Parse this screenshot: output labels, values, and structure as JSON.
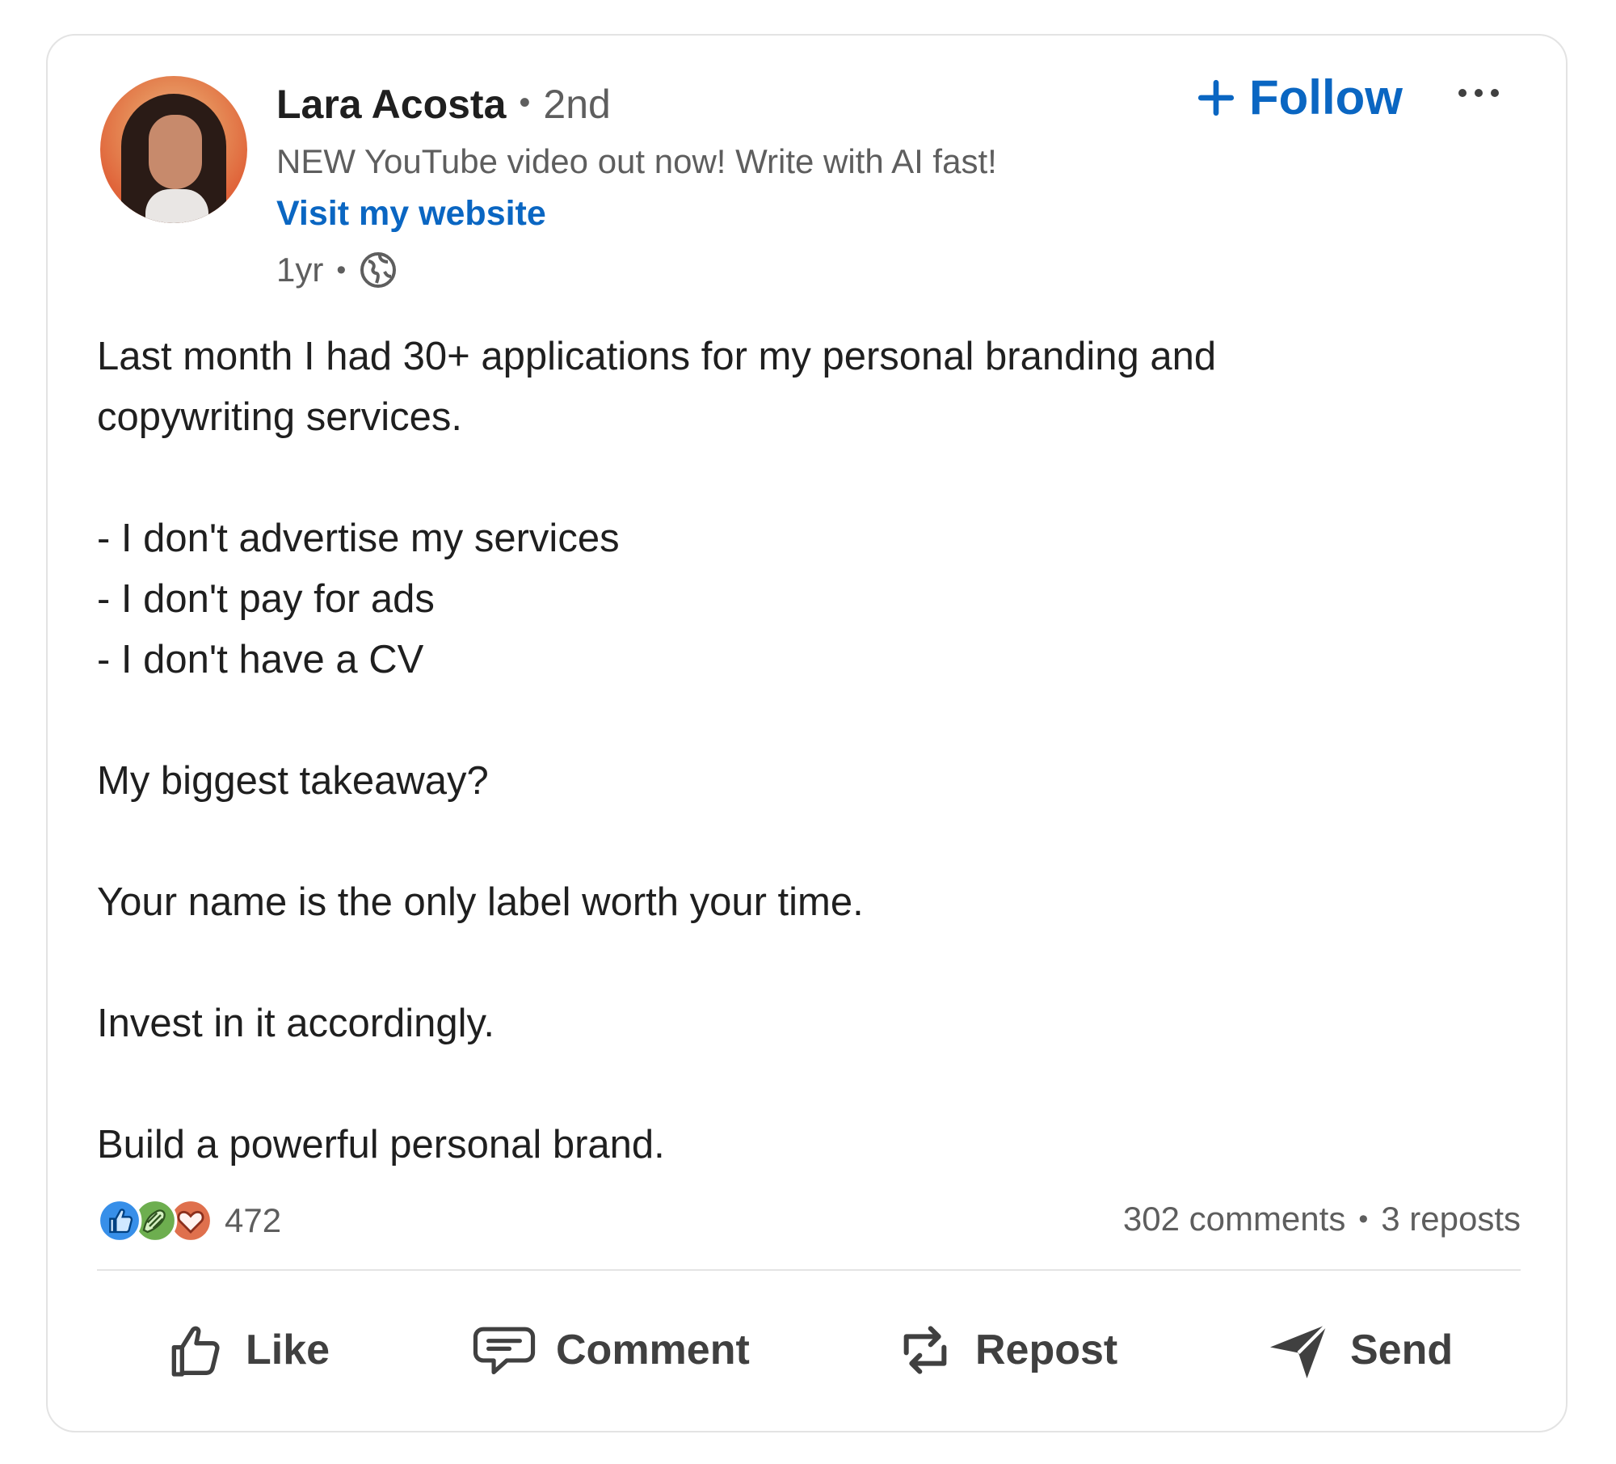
{
  "post": {
    "author": {
      "name": "Lara Acosta",
      "degree": "2nd",
      "headline": "NEW YouTube video out now! Write with AI fast!",
      "website_link": "Visit my website",
      "time": "1yr",
      "visibility_icon": "globe-icon"
    },
    "follow_label": "Follow",
    "more_icon": "more-options-icon",
    "body_lines": [
      "Last month I had 30+ applications for my personal branding and",
      "copywriting services.",
      "",
      "- I don't advertise my services",
      "- I don't pay for ads",
      "- I don't have a CV",
      "",
      "My biggest takeaway?",
      "",
      "Your name is the only label worth your time.",
      "",
      "Invest in it accordingly.",
      "",
      "Build a powerful personal brand."
    ],
    "reactions": {
      "icons": [
        "like-reaction-icon",
        "celebrate-reaction-icon",
        "love-reaction-icon"
      ],
      "count": "472"
    },
    "stats": {
      "comments": "302 comments",
      "reposts": "3 reposts"
    },
    "actions": {
      "like": "Like",
      "comment": "Comment",
      "repost": "Repost",
      "send": "Send"
    }
  },
  "colors": {
    "link_blue": "#0a66c2",
    "secondary_text": "#5e5e5e",
    "primary_text": "#1f1f1f",
    "like_blue": "#378fe9",
    "celebrate_green": "#44712e",
    "love_orange": "#df704d"
  }
}
